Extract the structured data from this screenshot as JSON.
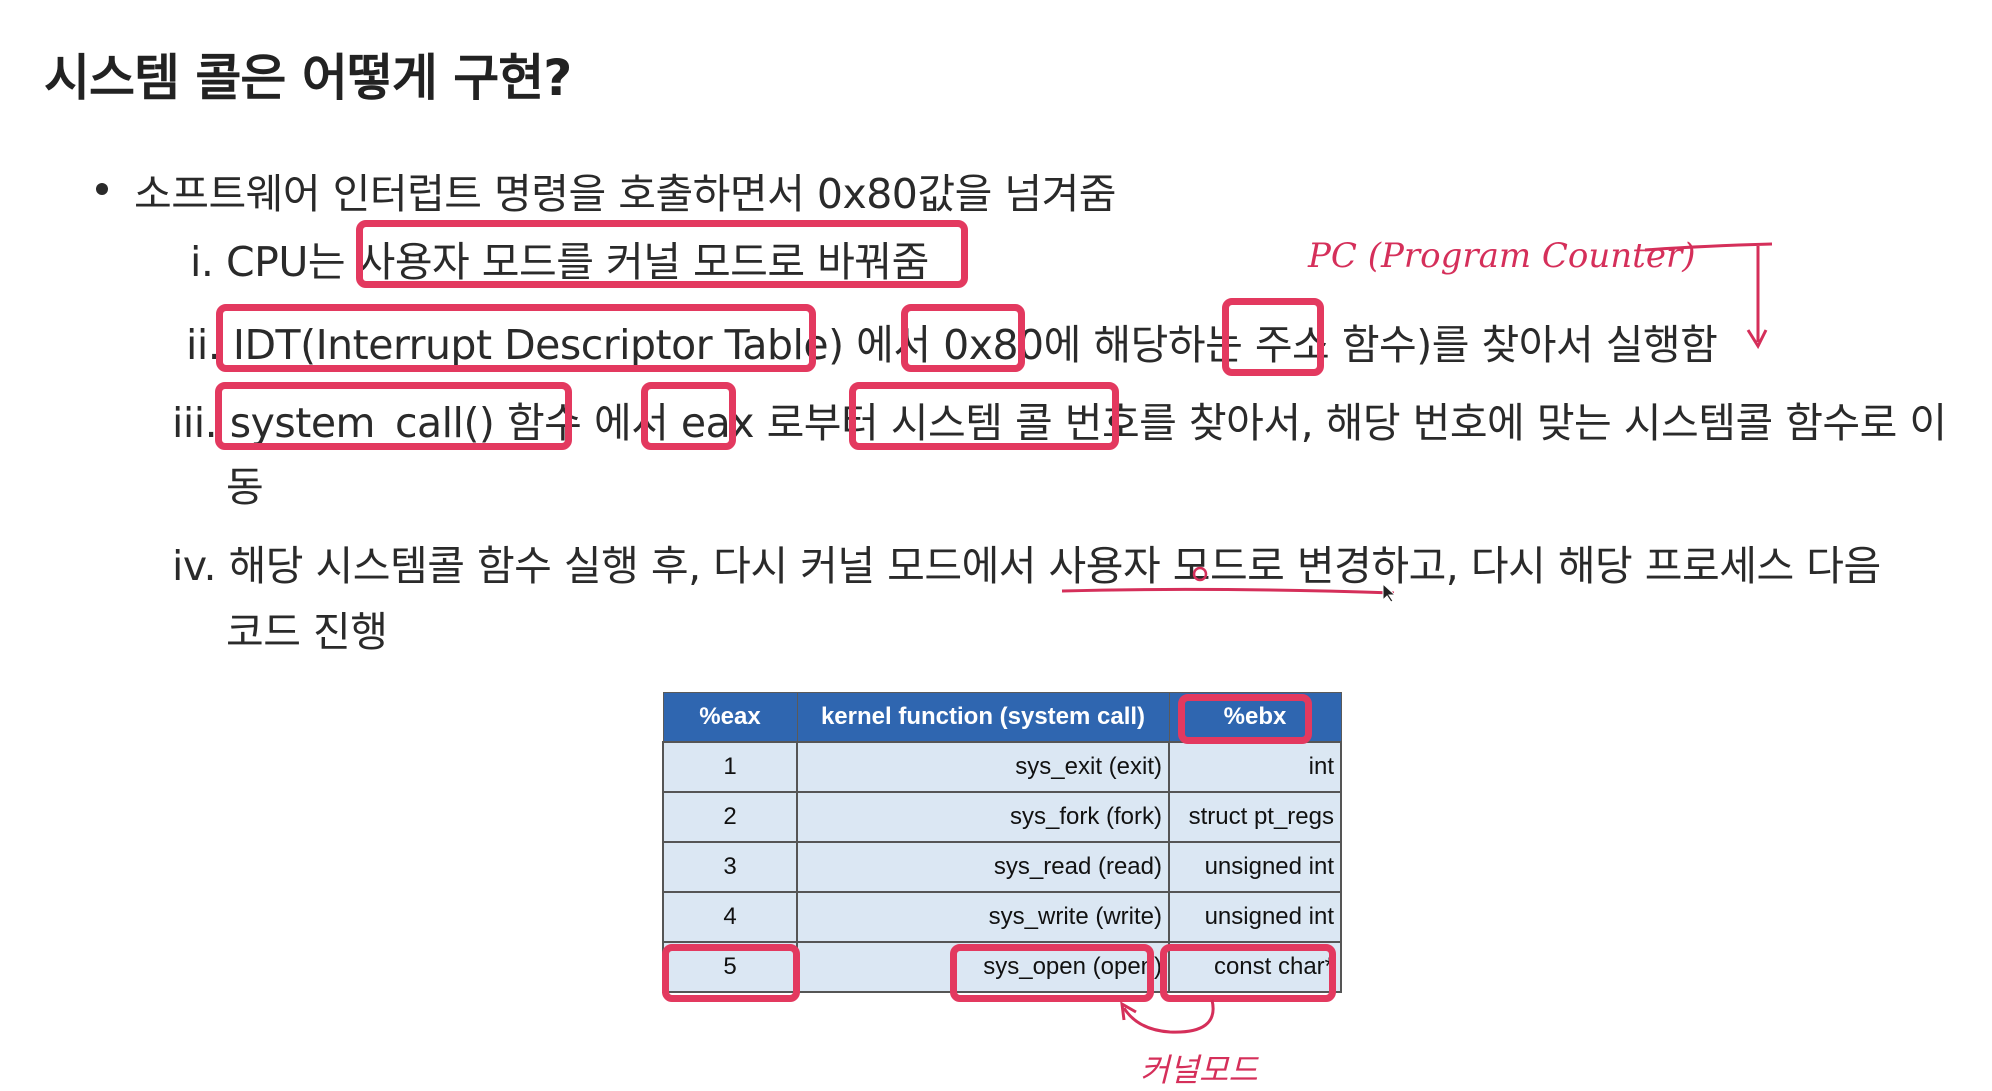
{
  "page": {
    "title": "시스템 콜은 어떻게 구현?",
    "bullet": "소프트웨어 인터럽트 명령을 호출하면서 0x80값을 넘겨줌",
    "steps": {
      "i": {
        "num": "i.",
        "pre": "CPU는 ",
        "hl": "사용자 모드를 커널 모드로 바꿔줌"
      },
      "ii": {
        "num": "ii.",
        "hl1": "IDT(Interrupt Descriptor Table)",
        "mid1": " 에서 ",
        "hl2": "0x80",
        "mid2": "에 해당하는 ",
        "hl3": "주소",
        "post": " 함수)를 찾아서 실행함"
      },
      "iii": {
        "num": "iii.",
        "hl1": "system_call() 함수",
        "mid1": " 에서 ",
        "hl2": "eax",
        "mid2": " 로부터 ",
        "hl3": "시스템 콜 번호",
        "post": "를 찾아서, 해당 번호에 맞는 시스템콜 함수로 이",
        "cont": "동"
      },
      "iv": {
        "num": "iv.",
        "text1": "해당 시스템콜 함수 실행 후, 다시 커널 모드에서 사용자 모드로 변경하고, 다시 해당 프로세스 다음",
        "text2": "코드 진행"
      }
    },
    "annotations": {
      "pc": "PC (Program Counter)",
      "kernel_mode": "커널모드"
    }
  },
  "colors": {
    "highlight": "#e3395f",
    "table_header": "#2f66b0",
    "table_cell": "#dbe7f3"
  },
  "table": {
    "headers": [
      "%eax",
      "kernel function (system call)",
      "%ebx"
    ],
    "rows": [
      [
        "1",
        "sys_exit (exit)",
        "int"
      ],
      [
        "2",
        "sys_fork (fork)",
        "struct pt_regs"
      ],
      [
        "3",
        "sys_read (read)",
        "unsigned int"
      ],
      [
        "4",
        "sys_write (write)",
        "unsigned int"
      ],
      [
        "5",
        "sys_open (open)",
        "const char*"
      ]
    ]
  }
}
